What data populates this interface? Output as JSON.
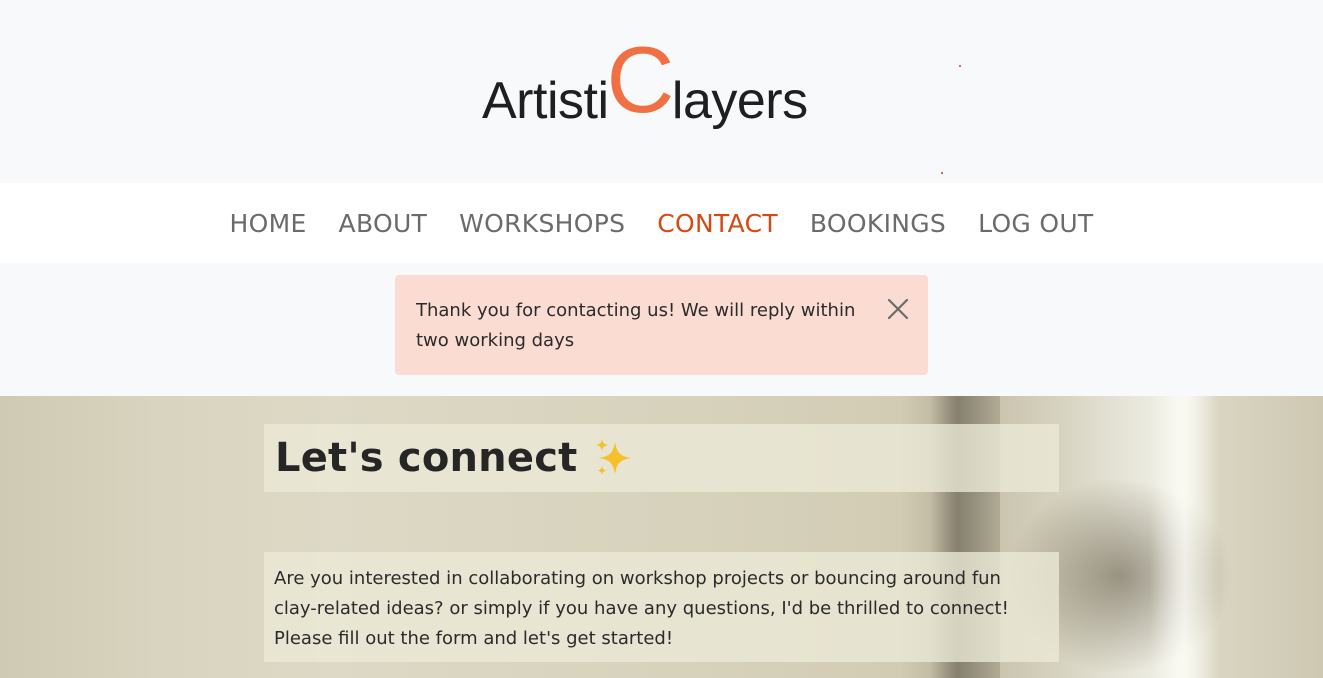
{
  "logo": {
    "part1": "Artisti",
    "big_letter": "C",
    "part2": "layers"
  },
  "nav": {
    "items": [
      {
        "label": "HOME"
      },
      {
        "label": "ABOUT"
      },
      {
        "label": "WORKSHOPS"
      },
      {
        "label": "CONTACT",
        "active": true
      },
      {
        "label": "BOOKINGS"
      },
      {
        "label": "LOG OUT"
      }
    ]
  },
  "alert": {
    "message": "Thank you for contacting us! We will reply within two working days",
    "close_icon": "close-icon"
  },
  "hero": {
    "heading": "Let's connect",
    "heading_icon": "sparkles-icon",
    "paragraph": "Are you interested in collaborating on workshop projects or bouncing around fun clay-related ideas? or simply if you have any questions, I'd be thrilled to connect! Please fill out the form and let's get started!"
  },
  "colors": {
    "brand_accent": "#f07043",
    "nav_active": "#d44a12",
    "nav_default": "#6b6b6b",
    "alert_bg": "#fadcd3"
  }
}
